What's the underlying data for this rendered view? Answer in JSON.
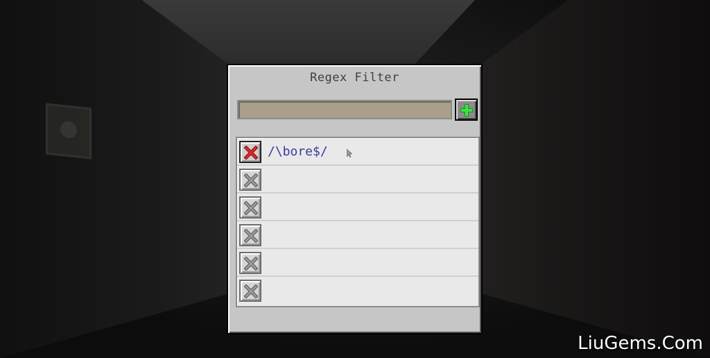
{
  "dialog": {
    "title": "Regex Filter",
    "input_value": "",
    "add_button_icon": "plus-icon",
    "accent_add": "#22c32c",
    "accent_delete_active": "#cc2020",
    "accent_delete_inactive": "#8a8a8a"
  },
  "filters": [
    {
      "text": "/\\bore$/",
      "delete_icon": "x-icon",
      "active": true
    },
    {
      "text": "",
      "delete_icon": "x-icon",
      "active": false
    },
    {
      "text": "",
      "delete_icon": "x-icon",
      "active": false
    },
    {
      "text": "",
      "delete_icon": "x-icon",
      "active": false
    },
    {
      "text": "",
      "delete_icon": "x-icon",
      "active": false
    },
    {
      "text": "",
      "delete_icon": "x-icon",
      "active": false
    }
  ],
  "watermark": "LiuGems.Com"
}
